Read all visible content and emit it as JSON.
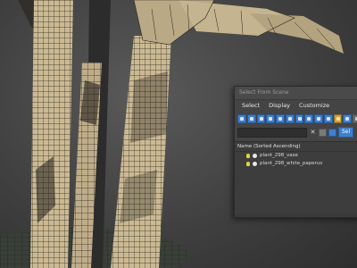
{
  "dialog": {
    "title": "Select From Scene",
    "menu": [
      "Select",
      "Display",
      "Customize"
    ],
    "select_button_label": "Sel"
  },
  "list": {
    "header": "Name (Sorted Ascending)",
    "items": [
      {
        "name": "plant_298_vase"
      },
      {
        "name": "plant_298_white_paperus"
      }
    ]
  },
  "colors": {
    "accent": "#3f7fcf",
    "light_icon": "#e6d03a",
    "stem": "#cdbb96",
    "wire": "#222222"
  }
}
